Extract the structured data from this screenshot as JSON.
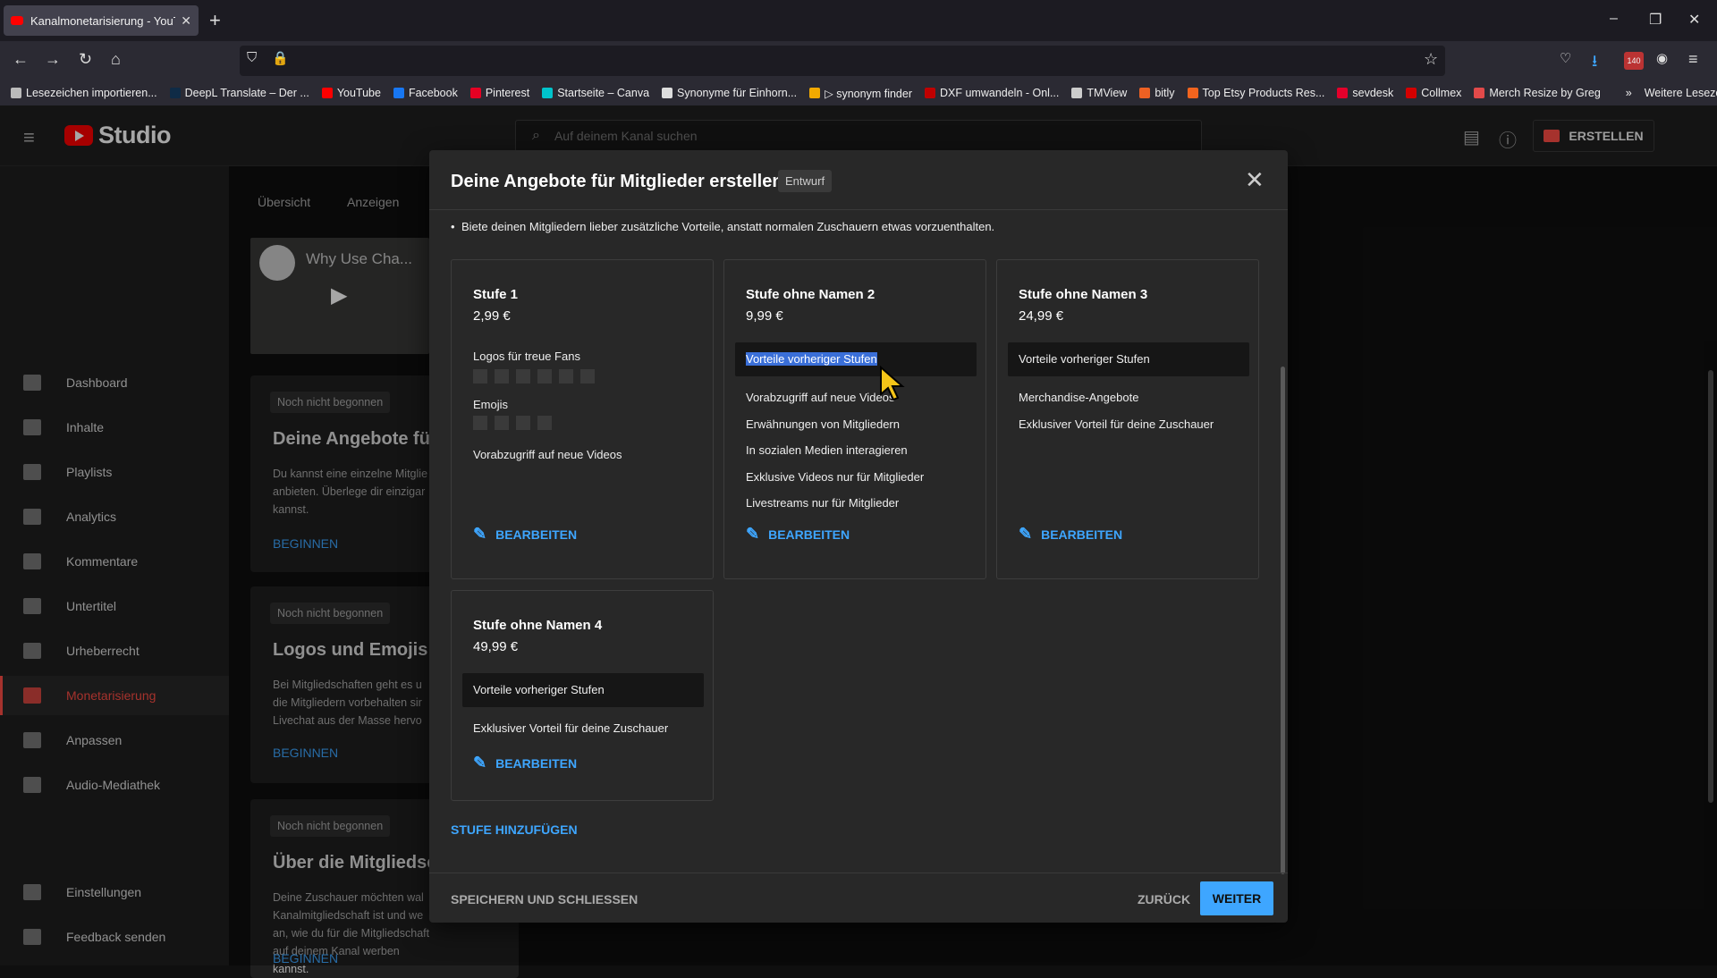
{
  "browser": {
    "tab_title": "Kanalmonetarisierung - YouTube",
    "tab_close": "✕",
    "new_tab": "+",
    "bookmarks": [
      {
        "label": "Lesezeichen importieren...",
        "color": "#bbbbbb"
      },
      {
        "label": "DeepL Translate – Der ...",
        "color": "#0f2b46"
      },
      {
        "label": "YouTube",
        "color": "#ff0000"
      },
      {
        "label": "Facebook",
        "color": "#1877f2"
      },
      {
        "label": "Pinterest",
        "color": "#e60023"
      },
      {
        "label": "Startseite – Canva",
        "color": "#00c4cc"
      },
      {
        "label": "Synonyme für Einhorn...",
        "color": "#dddddd"
      },
      {
        "label": "▷ synonym finder",
        "color": "#f2a900"
      },
      {
        "label": "DXF umwandeln - Onl...",
        "color": "#c00000"
      },
      {
        "label": "TMView",
        "color": "#cccccc"
      },
      {
        "label": "bitly",
        "color": "#ee6123"
      },
      {
        "label": "Top Etsy Products Res...",
        "color": "#f1641e"
      },
      {
        "label": "sevdesk",
        "color": "#e4002b"
      },
      {
        "label": "Collmex",
        "color": "#d40000"
      },
      {
        "label": "Merch Resize by Greg",
        "color": "#e24a4a"
      }
    ],
    "more_bookmarks": "Weitere Lesezeichen",
    "badge_count": "140"
  },
  "studio": {
    "logo_text": "Studio",
    "search_placeholder": "Auf deinem Kanal suchen",
    "create_label": "ERSTELLEN",
    "nav": [
      {
        "label": "Dashboard",
        "active": false
      },
      {
        "label": "Inhalte",
        "active": false
      },
      {
        "label": "Playlists",
        "active": false
      },
      {
        "label": "Analytics",
        "active": false
      },
      {
        "label": "Kommentare",
        "active": false
      },
      {
        "label": "Untertitel",
        "active": false
      },
      {
        "label": "Urheberrecht",
        "active": false
      },
      {
        "label": "Monetarisierung",
        "active": true
      },
      {
        "label": "Anpassen",
        "active": false
      },
      {
        "label": "Audio-Mediathek",
        "active": false
      }
    ],
    "nav_bottom": [
      "Einstellungen",
      "Feedback senden"
    ],
    "content_tabs": [
      "Übersicht",
      "Anzeigen"
    ],
    "video_title": "Why Use Cha...",
    "bg_cards": [
      {
        "chip": "Noch nicht begonnen",
        "heading": "Deine Angebote für",
        "text": "Du kannst eine einzelne Mitglie anbieten. Überlege dir einzigar kannst.",
        "button": "BEGINNEN"
      },
      {
        "chip": "Noch nicht begonnen",
        "heading": "Logos und Emojis h",
        "text": "Bei Mitgliedschaften geht es u die Mitgliedern vorbehalten sir Livechat aus der Masse hervo",
        "button": "BEGINNEN"
      },
      {
        "chip": "Noch nicht begonnen",
        "heading": "Über die Mitgliedsc",
        "text": "Deine Zuschauer möchten wal Kanalmitgliedschaft ist und we an, wie du für die Mitgliedschaft auf deinem Kanal werben kannst.",
        "button": "BEGINNEN"
      }
    ]
  },
  "dialog": {
    "title": "Deine Angebote für Mitglieder erstellen",
    "badge": "Entwurf",
    "bullet": "Biete deinen Mitgliedern lieber zusätzliche Vorteile, anstatt normalen Zuschauern etwas vorzuenthalten.",
    "edit_label": "BEARBEITEN",
    "prev_benefits": "Vorteile vorheriger Stufen",
    "tiers": [
      {
        "name": "Stufe 1",
        "price": "2,99 €",
        "logos_label": "Logos für treue Fans",
        "emojis_label": "Emojis",
        "perks": [
          "Vorabzugriff auf neue Videos"
        ]
      },
      {
        "name": "Stufe ohne Namen 2",
        "price": "9,99 €",
        "perks": [
          "Vorabzugriff auf neue Videos",
          "Erwähnungen von Mitgliedern",
          "In sozialen Medien interagieren",
          "Exklusive Videos nur für Mitglieder",
          "Livestreams nur für Mitglieder"
        ]
      },
      {
        "name": "Stufe ohne Namen 3",
        "price": "24,99 €",
        "perks": [
          "Merchandise-Angebote",
          "Exklusiver Vorteil für deine Zuschauer"
        ]
      },
      {
        "name": "Stufe ohne Namen 4",
        "price": "49,99 €",
        "perks": [
          "Exklusiver Vorteil für deine Zuschauer"
        ]
      }
    ],
    "add_tier": "STUFE HINZUFÜGEN",
    "save_close": "SPEICHERN UND SCHLIESSEN",
    "back": "ZURÜCK",
    "next": "WEITER"
  },
  "colors": {
    "accent": "#3ea6ff",
    "brand": "#ff0000",
    "active_nav": "#ff4e45",
    "selection": "#3a6fd8"
  }
}
